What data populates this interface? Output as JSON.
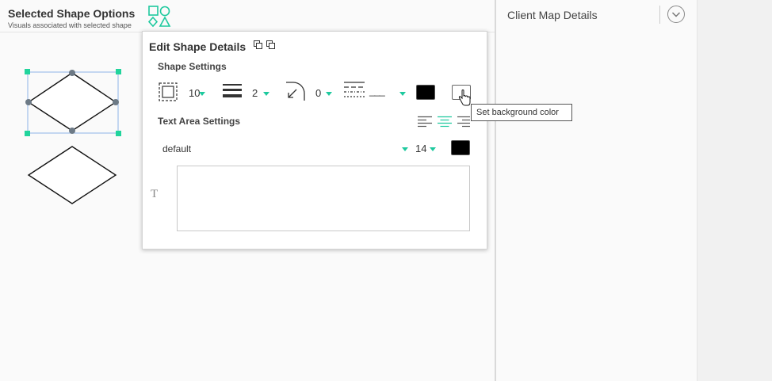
{
  "header": {
    "title": "Selected Shape Options",
    "subtitle": "Visuals associated with selected shape",
    "shapes_icon": "shapes-icon"
  },
  "right_panel": {
    "title": "Client Map Details",
    "expand_icon": "chevron-down-circle-icon"
  },
  "popup": {
    "title": "Edit Shape Details",
    "copy_icon": "copy-icon",
    "paste_icon": "paste-icon",
    "shape_settings": {
      "label": "Shape Settings",
      "padding_value": "10",
      "border_width_value": "2",
      "corner_radius_value": "0",
      "border_style_value": "___",
      "border_color": "#000000",
      "background_color": "#ffffff"
    },
    "text_settings": {
      "label": "Text Area Settings",
      "font": "default",
      "font_size": "14",
      "text_color": "#000000",
      "alignment_selected": "center",
      "text_value": ""
    }
  },
  "tooltip": {
    "text": "Set background color"
  },
  "colors": {
    "accent": "#1ec99e",
    "selection_handle": "#21d49c",
    "selection_box": "#8fb4e8"
  }
}
